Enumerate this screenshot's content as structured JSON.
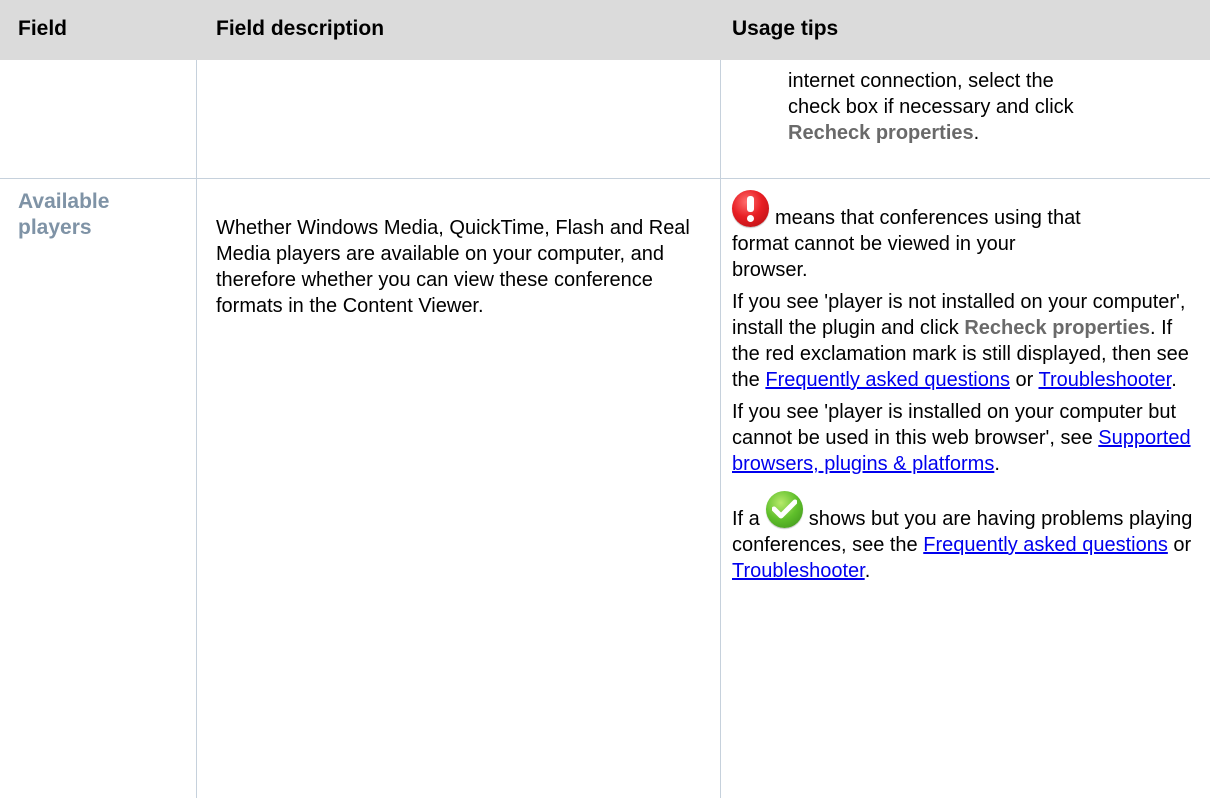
{
  "header": {
    "col1": "Field",
    "col2": "Field description",
    "col3": "Usage tips"
  },
  "continued_row": {
    "tip_line1": "internet connection, select the",
    "tip_line2": "check box if necessary and click",
    "tip_link": "Recheck properties",
    "tip_end": "."
  },
  "row": {
    "field_name": "Available players",
    "description": "Whether Windows Media, QuickTime, Flash and Real Media players are available on your computer, and therefore whether you can view these conference formats in the Content Viewer.",
    "tip1_icon": "red-exclamation-icon",
    "tip1_line1": "means that conferences using that",
    "tip1_line2": "format cannot be viewed in your",
    "tip1_line3": "browser.",
    "tip2_a": "If you see 'player is not installed on your computer', install the plugin and click",
    "tip2_strong": "Recheck properties",
    "tip2_b": ". If the red exclamation mark is still displayed, then see the",
    "tip2_link1": "Frequently asked questions",
    "tip2_c": " or",
    "tip2_link2": "Troubleshooter",
    "tip2_end": ".",
    "tip3_a": "If you see 'player is installed on your computer but cannot be used in this web browser', see",
    "tip3_link": "Supported browsers, plugins & platforms",
    "tip3_end": ".",
    "tip4_icon": "green-check-icon",
    "tip4_a": "If a",
    "tip4_b": "shows but you are having problems playing conferences, see the",
    "tip4_link1": "Frequently asked questions",
    "tip4_c": " or",
    "tip4_link2": "Troubleshooter",
    "tip4_end": "."
  },
  "colors": {
    "header_bg": "#dbdbdb",
    "grid_line": "#c6d1dc",
    "field_name": "#7f93a6",
    "link": "#0000ee"
  }
}
